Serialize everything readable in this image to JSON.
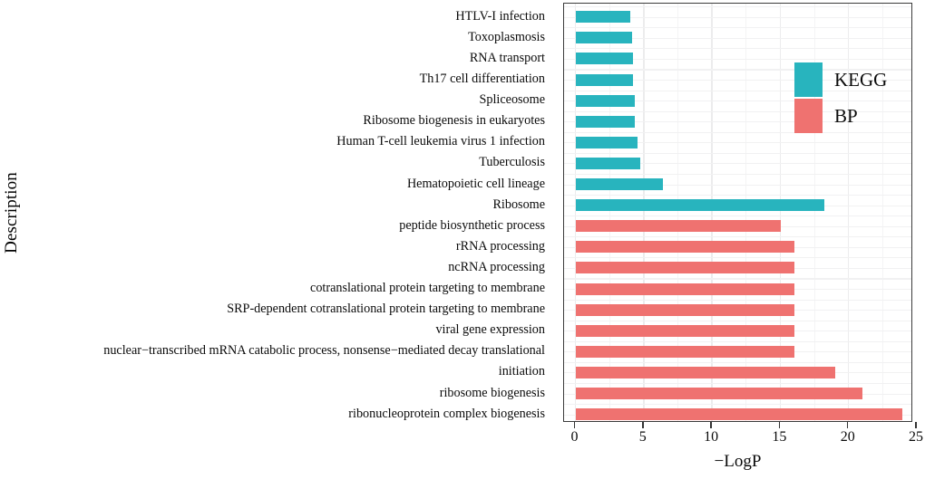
{
  "chart_data": {
    "type": "bar",
    "orientation": "horizontal",
    "title": "",
    "xlabel": "−LogP",
    "ylabel": "Description",
    "xlim": [
      0,
      25
    ],
    "xticks": [
      0,
      5,
      10,
      15,
      20,
      25
    ],
    "xtick_labels": [
      "0",
      "5",
      "10",
      "15",
      "20",
      "25"
    ],
    "grid": true,
    "legend_position": "top-right",
    "colors": {
      "KEGG": "#28b4be",
      "BP": "#ef7270"
    },
    "legend": [
      {
        "label": "KEGG",
        "color": "#28b4be"
      },
      {
        "label": "BP",
        "color": "#ef7270"
      }
    ],
    "categories": [
      "HTLV-I infection",
      "Toxoplasmosis",
      "RNA transport",
      "Th17 cell differentiation",
      "Spliceosome",
      "Ribosome biogenesis in eukaryotes",
      "Human T-cell leukemia virus 1 infection",
      "Tuberculosis",
      "Hematopoietic cell lineage",
      "Ribosome",
      "peptide biosynthetic process",
      "rRNA processing",
      "ncRNA processing",
      "cotranslational protein targeting to membrane",
      "SRP-dependent cotranslational protein targeting to membrane",
      "viral gene expression",
      "nuclear−transcribed mRNA catabolic process, nonsense−mediated decay translational",
      "initiation",
      "ribosome biogenesis",
      "ribonucleoprotein complex biogenesis"
    ],
    "values": [
      4.0,
      4.1,
      4.2,
      4.2,
      4.3,
      4.3,
      4.5,
      4.7,
      6.4,
      18.2,
      15.0,
      16.0,
      16.0,
      16.0,
      16.0,
      16.0,
      16.0,
      19.0,
      21.0,
      23.9
    ],
    "groups": [
      "KEGG",
      "KEGG",
      "KEGG",
      "KEGG",
      "KEGG",
      "KEGG",
      "KEGG",
      "KEGG",
      "KEGG",
      "KEGG",
      "BP",
      "BP",
      "BP",
      "BP",
      "BP",
      "BP",
      "BP",
      "BP",
      "BP",
      "BP"
    ]
  }
}
